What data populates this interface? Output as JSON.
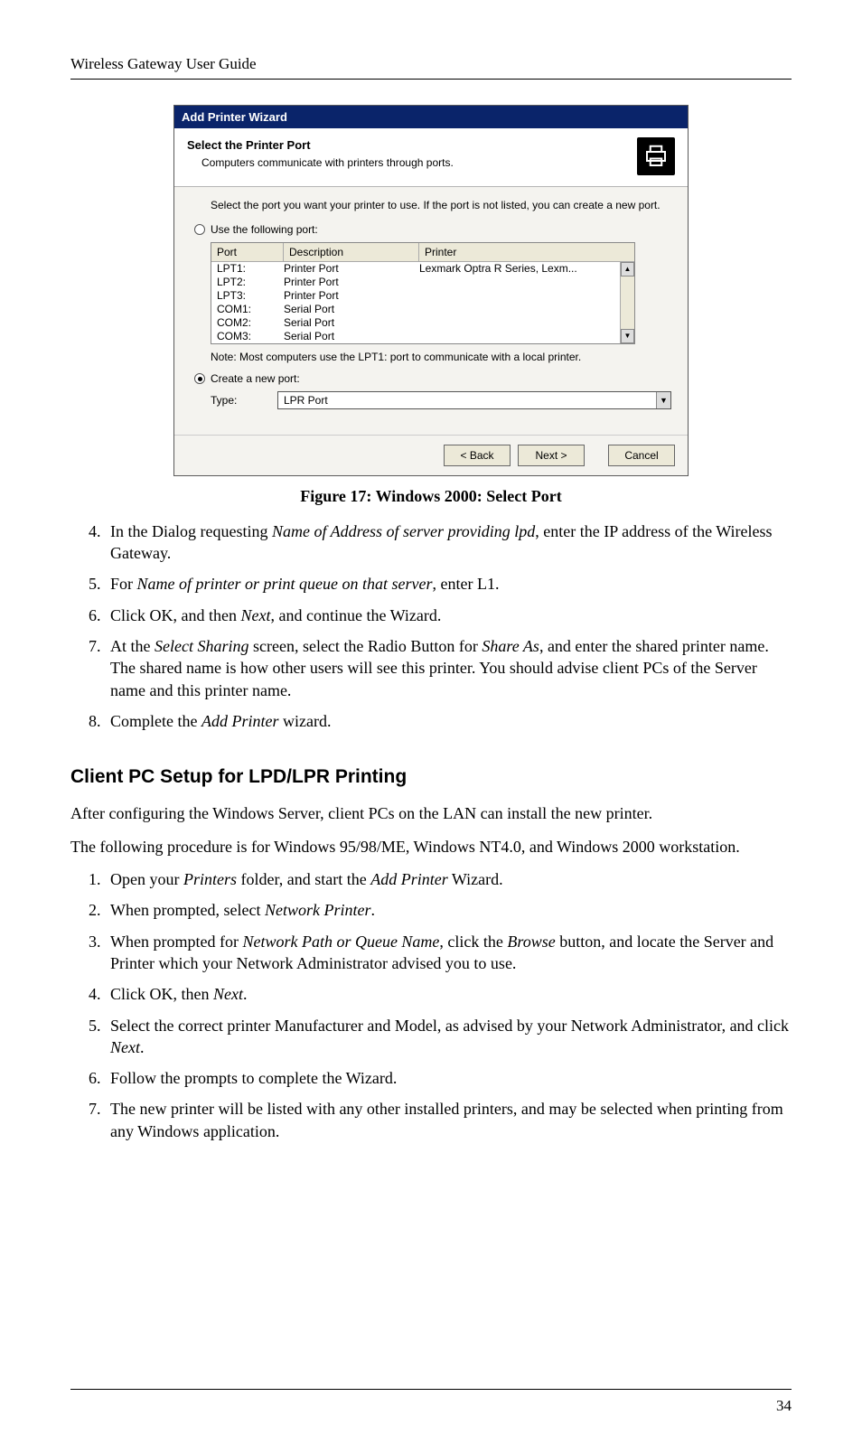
{
  "header_text": "Wireless Gateway User Guide",
  "dialog": {
    "title": "Add Printer Wizard",
    "head_title": "Select the Printer Port",
    "head_sub": "Computers communicate with printers through ports.",
    "intro": "Select the port you want your printer to use.  If the port is not listed, you can create a new port.",
    "radio_use": "Use the following port:",
    "cols": {
      "port": "Port",
      "desc": "Description",
      "printer": "Printer"
    },
    "rows": [
      {
        "port": "LPT1:",
        "desc": "Printer Port",
        "printer": "Lexmark Optra R Series, Lexm..."
      },
      {
        "port": "LPT2:",
        "desc": "Printer Port",
        "printer": ""
      },
      {
        "port": "LPT3:",
        "desc": "Printer Port",
        "printer": ""
      },
      {
        "port": "COM1:",
        "desc": "Serial Port",
        "printer": ""
      },
      {
        "port": "COM2:",
        "desc": "Serial Port",
        "printer": ""
      },
      {
        "port": "COM3:",
        "desc": "Serial Port",
        "printer": ""
      }
    ],
    "note": "Note: Most computers use the LPT1: port to communicate with a local printer.",
    "radio_create": "Create a new port:",
    "type_label": "Type:",
    "type_value": "LPR Port",
    "btn_back": "< Back",
    "btn_next": "Next >",
    "btn_cancel": "Cancel"
  },
  "caption": "Figure 17: Windows 2000: Select Port",
  "steps_a": {
    "s4a": "In the Dialog requesting ",
    "s4i": "Name of Address of server providing lpd",
    "s4b": ", enter the IP address of the Wireless Gateway.",
    "s5a": "For ",
    "s5i": "Name of printer or print queue on that server",
    "s5b": ", enter L1.",
    "s6a": "Click OK, and then ",
    "s6i": "Next",
    "s6b": ", and continue the Wizard.",
    "s7a": "At the ",
    "s7i1": "Select Sharing",
    "s7m": " screen, select the Radio Button for ",
    "s7i2": "Share As",
    "s7b": ", and enter the shared printer name. The shared name is how other users will see this printer. You should advise client PCs of the Server name and this printer name.",
    "s8a": "Complete the ",
    "s8i": "Add Printer",
    "s8b": " wizard."
  },
  "section_title": "Client PC Setup for LPD/LPR Printing",
  "para1": "After configuring the Windows Server, client PCs on the LAN can install the new printer.",
  "para2": "The following procedure is for Windows 95/98/ME, Windows NT4.0, and Windows 2000 workstation.",
  "steps_b": {
    "s1a": "Open your ",
    "s1i": "Printers",
    "s1m": " folder, and start the ",
    "s1i2": "Add Printer",
    "s1b": " Wizard.",
    "s2a": "When prompted, select ",
    "s2i": "Network Printer",
    "s2b": ".",
    "s3a": "When prompted for ",
    "s3i": "Network Path or Queue Name",
    "s3m": ", click the ",
    "s3i2": "Browse",
    "s3b": " button, and locate the Server and Printer which your Network Administrator advised you to use.",
    "s4a": "Click OK, then ",
    "s4i": "Next",
    "s4b": ".",
    "s5a": "Select the correct printer Manufacturer and Model, as advised by your Network Administrator, and click ",
    "s5i": "Next",
    "s5b": ".",
    "s6": "Follow the prompts to complete the Wizard.",
    "s7": "The new printer will be listed with any other installed printers, and may be selected when printing from any Windows application."
  },
  "page_number": "34"
}
